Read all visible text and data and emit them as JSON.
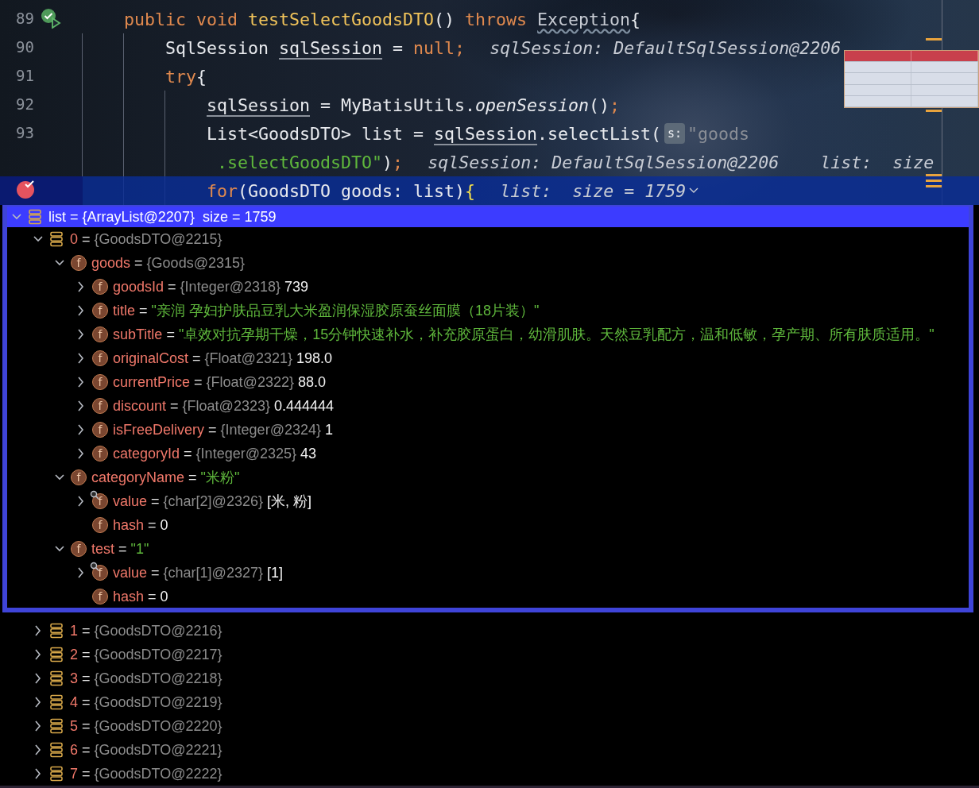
{
  "editor": {
    "lines": [
      {
        "number": "89",
        "kind": "run",
        "highlighted": false,
        "segments": [
          {
            "kind": "code",
            "tokens": [
              {
                "kind": "keyword",
                "text": "public void "
              },
              {
                "kind": "method",
                "text": "testSelectGoodsDTO"
              },
              {
                "kind": "plain",
                "text": "() "
              },
              {
                "kind": "keyword",
                "text": "throws "
              },
              {
                "kind": "warning",
                "text": "Exception"
              },
              {
                "kind": "plain",
                "text": "{"
              }
            ]
          }
        ],
        "children": [
          {
            "number": "90",
            "highlighted": false,
            "segments": [
              {
                "kind": "code",
                "tokens": [
                  {
                    "kind": "plain",
                    "text": "SqlSession "
                  },
                  {
                    "kind": "var",
                    "text": "sqlSession"
                  },
                  {
                    "kind": "plain",
                    "text": " = "
                  },
                  {
                    "kind": "keyword",
                    "text": "null;"
                  }
                ]
              },
              {
                "kind": "hint",
                "text": "sqlSession: DefaultSqlSession@2206"
              }
            ]
          },
          {
            "number": "91",
            "highlighted": false,
            "segments": [
              {
                "kind": "code",
                "tokens": [
                  {
                    "kind": "keyword",
                    "text": "try"
                  },
                  {
                    "kind": "plain",
                    "text": "{"
                  }
                ]
              }
            ],
            "children": [
              {
                "number": "92",
                "highlighted": false,
                "segments": [
                  {
                    "kind": "code",
                    "tokens": [
                      {
                        "kind": "var",
                        "text": "sqlSession"
                      },
                      {
                        "kind": "plain",
                        "text": " = MyBatisUtils."
                      },
                      {
                        "kind": "static",
                        "text": "openSession"
                      },
                      {
                        "kind": "plain",
                        "text": "()"
                      },
                      {
                        "kind": "keyword",
                        "text": ";"
                      }
                    ]
                  }
                ]
              },
              {
                "number": "93",
                "highlighted": false,
                "segments": [
                  {
                    "kind": "code",
                    "tokens": [
                      {
                        "kind": "plain",
                        "text": "List<GoodsDTO> list = "
                      },
                      {
                        "kind": "var",
                        "text": "sqlSession"
                      },
                      {
                        "kind": "plain",
                        "text": ".selectList("
                      }
                    ]
                  },
                  {
                    "kind": "param_hint",
                    "text": "s:"
                  },
                  {
                    "kind": "code",
                    "tokens": [
                      {
                        "kind": "dimstring",
                        "text": "\"goods"
                      }
                    ]
                  }
                ]
              },
              {
                "kind": "continuation",
                "highlighted": false,
                "segments": [
                  {
                    "kind": "code",
                    "tokens": [
                      {
                        "kind": "string",
                        "text": ".selectGoodsDTO\""
                      },
                      {
                        "kind": "plain",
                        "text": ")"
                      },
                      {
                        "kind": "keyword",
                        "text": ";"
                      }
                    ]
                  },
                  {
                    "kind": "hint",
                    "text": "sqlSession: DefaultSqlSession@2206    list:  size"
                  }
                ]
              },
              {
                "kind": "breakpoint",
                "highlighted": true,
                "segments": [
                  {
                    "kind": "code",
                    "tokens": [
                      {
                        "kind": "keyword",
                        "text": "for"
                      },
                      {
                        "kind": "plain",
                        "text": "(GoodsDTO goods: list)"
                      },
                      {
                        "kind": "brace",
                        "text": "{"
                      }
                    ]
                  },
                  {
                    "kind": "hint",
                    "text": "list:  size = 1759"
                  },
                  {
                    "kind": "expand_chevron"
                  }
                ]
              }
            ]
          }
        ]
      }
    ]
  },
  "variables": {
    "name": "list",
    "eq": "=",
    "type": "{ArrayList@2207}",
    "value": "size = 1759",
    "is_string": false,
    "kind": "array",
    "expandable": true,
    "selected": true,
    "overlay": false,
    "children": [
      {
        "name": "0",
        "eq": "=",
        "type": "{GoodsDTO@2215}",
        "kind": "array",
        "expandable": true,
        "selected": false,
        "overlay": false,
        "children": [
          {
            "name": "goods",
            "eq": "=",
            "type": "{Goods@2315}",
            "kind": "field",
            "icon_letter": "f",
            "expandable": true,
            "selected": false,
            "overlay": false,
            "children": [
              {
                "name": "goodsId",
                "eq": "=",
                "type": "{Integer@2318}",
                "value": "739",
                "is_string": false,
                "kind": "field",
                "icon_letter": "f",
                "expandable": true,
                "selected": false,
                "overlay": false
              },
              {
                "name": "title",
                "eq": "=",
                "value": "\"亲润 孕妇护肤品豆乳大米盈润保湿胶原蚕丝面膜（18片装）\"",
                "is_string": true,
                "kind": "field",
                "icon_letter": "f",
                "expandable": true,
                "selected": false,
                "overlay": false
              },
              {
                "name": "subTitle",
                "eq": "=",
                "value": "\"卓效对抗孕期干燥，15分钟快速补水，补充胶原蛋白，幼滑肌肤。天然豆乳配方，温和低敏，孕产期、所有肤质适用。\"",
                "is_string": true,
                "kind": "field",
                "icon_letter": "f",
                "expandable": true,
                "selected": false,
                "overlay": false
              },
              {
                "name": "originalCost",
                "eq": "=",
                "type": "{Float@2321}",
                "value": "198.0",
                "is_string": false,
                "kind": "field",
                "icon_letter": "f",
                "expandable": true,
                "selected": false,
                "overlay": false
              },
              {
                "name": "currentPrice",
                "eq": "=",
                "type": "{Float@2322}",
                "value": "88.0",
                "is_string": false,
                "kind": "field",
                "icon_letter": "f",
                "expandable": true,
                "selected": false,
                "overlay": false
              },
              {
                "name": "discount",
                "eq": "=",
                "type": "{Float@2323}",
                "value": "0.444444",
                "is_string": false,
                "kind": "field",
                "icon_letter": "f",
                "expandable": true,
                "selected": false,
                "overlay": false
              },
              {
                "name": "isFreeDelivery",
                "eq": "=",
                "type": "{Integer@2324}",
                "value": "1",
                "is_string": false,
                "kind": "field",
                "icon_letter": "f",
                "expandable": true,
                "selected": false,
                "overlay": false
              },
              {
                "name": "categoryId",
                "eq": "=",
                "type": "{Integer@2325}",
                "value": "43",
                "is_string": false,
                "kind": "field",
                "icon_letter": "f",
                "expandable": true,
                "selected": false,
                "overlay": false
              }
            ]
          },
          {
            "name": "categoryName",
            "eq": "=",
            "value": "\"米粉\"",
            "is_string": true,
            "kind": "field",
            "icon_letter": "f",
            "expandable": true,
            "selected": false,
            "overlay": false,
            "children": [
              {
                "name": "value",
                "eq": "=",
                "type": "{char[2]@2326}",
                "value": "[米, 粉]",
                "is_string": false,
                "kind": "field",
                "icon_letter": "f",
                "expandable": true,
                "selected": false,
                "overlay": true
              },
              {
                "name": "hash",
                "eq": "=",
                "value": "0",
                "is_string": false,
                "kind": "field",
                "icon_letter": "f",
                "expandable": false,
                "selected": false,
                "overlay": false
              }
            ]
          },
          {
            "name": "test",
            "eq": "=",
            "value": "\"1\"",
            "is_string": true,
            "kind": "field",
            "icon_letter": "f",
            "expandable": true,
            "selected": false,
            "overlay": false,
            "children": [
              {
                "name": "value",
                "eq": "=",
                "type": "{char[1]@2327}",
                "value": "[1]",
                "is_string": false,
                "kind": "field",
                "icon_letter": "f",
                "expandable": true,
                "selected": false,
                "overlay": true
              },
              {
                "name": "hash",
                "eq": "=",
                "value": "0",
                "is_string": false,
                "kind": "field",
                "icon_letter": "f",
                "expandable": false,
                "selected": false,
                "overlay": false
              }
            ]
          }
        ]
      },
      {
        "name": "1",
        "eq": "=",
        "type": "{GoodsDTO@2216}",
        "kind": "array",
        "expandable": true,
        "selected": false,
        "overlay": false
      },
      {
        "name": "2",
        "eq": "=",
        "type": "{GoodsDTO@2217}",
        "kind": "array",
        "expandable": true,
        "selected": false,
        "overlay": false
      },
      {
        "name": "3",
        "eq": "=",
        "type": "{GoodsDTO@2218}",
        "kind": "array",
        "expandable": true,
        "selected": false,
        "overlay": false
      },
      {
        "name": "4",
        "eq": "=",
        "type": "{GoodsDTO@2219}",
        "kind": "array",
        "expandable": true,
        "selected": false,
        "overlay": false
      },
      {
        "name": "5",
        "eq": "=",
        "type": "{GoodsDTO@2220}",
        "kind": "array",
        "expandable": true,
        "selected": false,
        "overlay": false
      },
      {
        "name": "6",
        "eq": "=",
        "type": "{GoodsDTO@2221}",
        "kind": "array",
        "expandable": true,
        "selected": false,
        "overlay": false
      },
      {
        "name": "7",
        "eq": "=",
        "type": "{GoodsDTO@2222}",
        "kind": "array",
        "expandable": true,
        "selected": false,
        "overlay": false
      }
    ]
  }
}
